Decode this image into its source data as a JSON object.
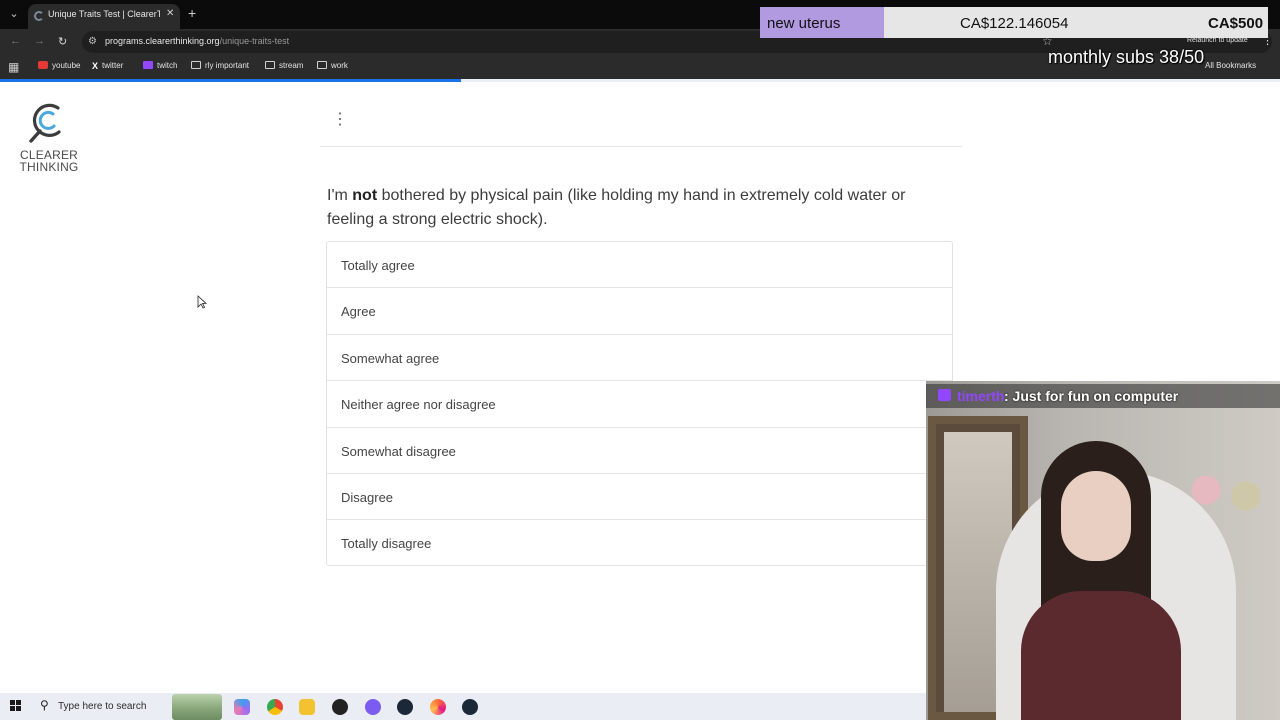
{
  "browser": {
    "tab_title": "Unique Traits Test | ClearerThinki",
    "url_domain": "programs.clearerthinking.org",
    "url_path": "/unique-traits-test",
    "relaunch_label": "Relaunch to update",
    "bookmarks": [
      {
        "label": "youtube",
        "icon": "youtube-icon"
      },
      {
        "label": "twitter",
        "icon": "x-icon"
      },
      {
        "label": "twitch",
        "icon": "twitch-icon"
      },
      {
        "label": "rly important",
        "icon": "folder-icon"
      },
      {
        "label": "stream",
        "icon": "folder-icon"
      },
      {
        "label": "work",
        "icon": "folder-icon"
      }
    ],
    "all_bookmarks_label": "All Bookmarks",
    "page_progress": 0.36
  },
  "logo": {
    "line1": "CLEARER",
    "line2": "THINKING",
    "accent": "#4aa8e0"
  },
  "question": {
    "prefix": "I'm ",
    "emphasis": "not",
    "rest": " bothered by physical pain (like holding my hand in extremely cold water or feeling a strong electric shock)."
  },
  "options": [
    "Totally agree",
    "Agree",
    "Somewhat agree",
    "Neither agree nor disagree",
    "Somewhat disagree",
    "Disagree",
    "Totally disagree"
  ],
  "taskbar": {
    "search_placeholder": "Type here to search"
  },
  "overlay": {
    "donation_label": "new uterus",
    "donation_current": "CA$122.146054",
    "donation_goal": "CA$500",
    "donation_color": "#b29ae0",
    "subs_counter": "monthly subs 38/50",
    "chat_user": "timerth",
    "chat_message": ": Just for fun on computer",
    "chat_user_color": "#9146ff"
  }
}
